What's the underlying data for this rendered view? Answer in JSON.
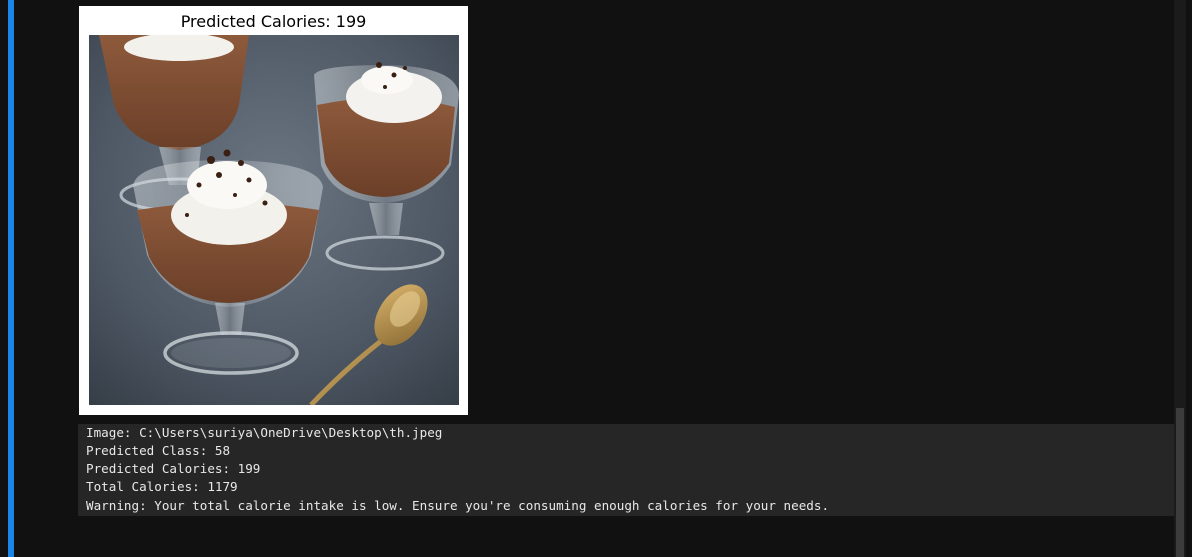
{
  "plot": {
    "title": "Predicted Calories: 199",
    "image_subject": "chocolate-mousse-dessert-photo"
  },
  "stdout": {
    "lines": [
      "Image: C:\\Users\\suriya\\OneDrive\\Desktop\\th.jpeg",
      "Predicted Class: 58",
      "Predicted Calories: 199",
      "Total Calories: 1179",
      "Warning: Your total calorie intake is low. Ensure you're consuming enough calories for your needs."
    ]
  },
  "colors": {
    "background": "#111111",
    "cell_indicator": "#1a86e8",
    "stdout_background": "#262626",
    "stdout_text": "#e8e8e8"
  }
}
